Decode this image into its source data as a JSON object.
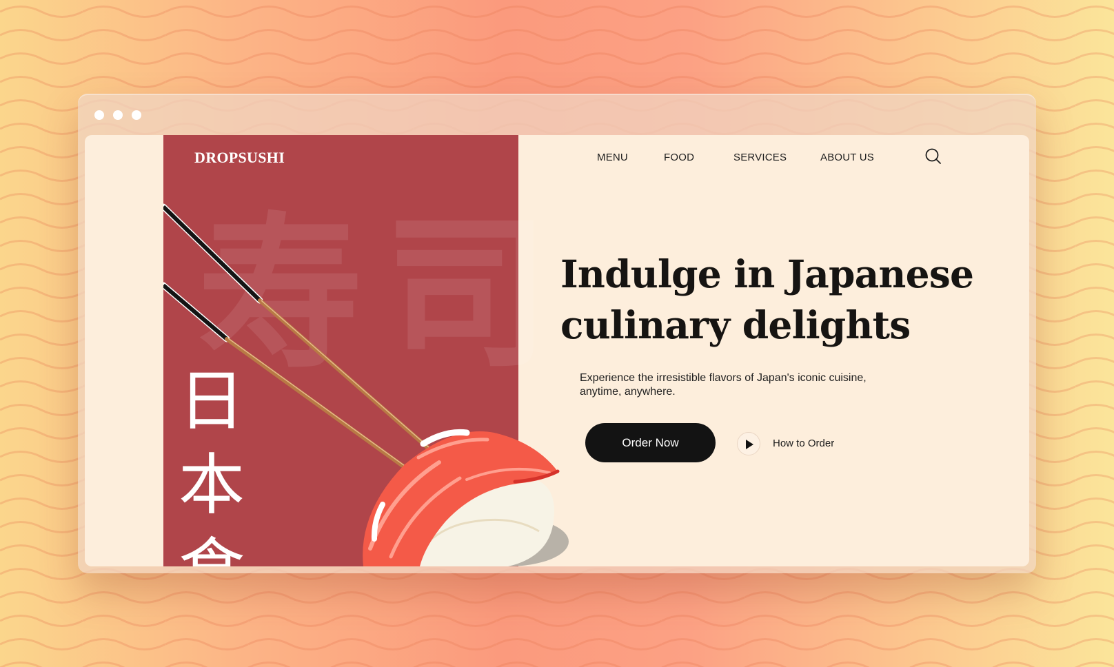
{
  "browser": {
    "window_controls": [
      "dot",
      "dot",
      "dot"
    ]
  },
  "site": {
    "brand": "DROPSUSHI",
    "nav": {
      "items": [
        "MENU",
        "FOOD",
        "SERVICES",
        "ABOUT US"
      ],
      "search_icon": "search-icon"
    },
    "hero": {
      "vertical_text": [
        "日",
        "本",
        "食"
      ],
      "headline_line1": "Indulge in Japanese",
      "headline_line2": "culinary delights",
      "subtext_line1": "Experience the irresistible flavors of Japan's iconic cuisine,",
      "subtext_line2": "anytime, anywhere.",
      "order_button": "Order Now",
      "howto_label": "How to Order",
      "howto_icon": "play-icon"
    },
    "illustration": {
      "subject": "salmon nigiri held by chopsticks",
      "icons": [
        "chopsticks-icon",
        "salmon-nigiri-icon"
      ]
    }
  },
  "colors": {
    "panel_red": "#b0454a",
    "page_cream": "#fdeedc",
    "button_black": "#131313",
    "salmon": "#f45a48"
  }
}
